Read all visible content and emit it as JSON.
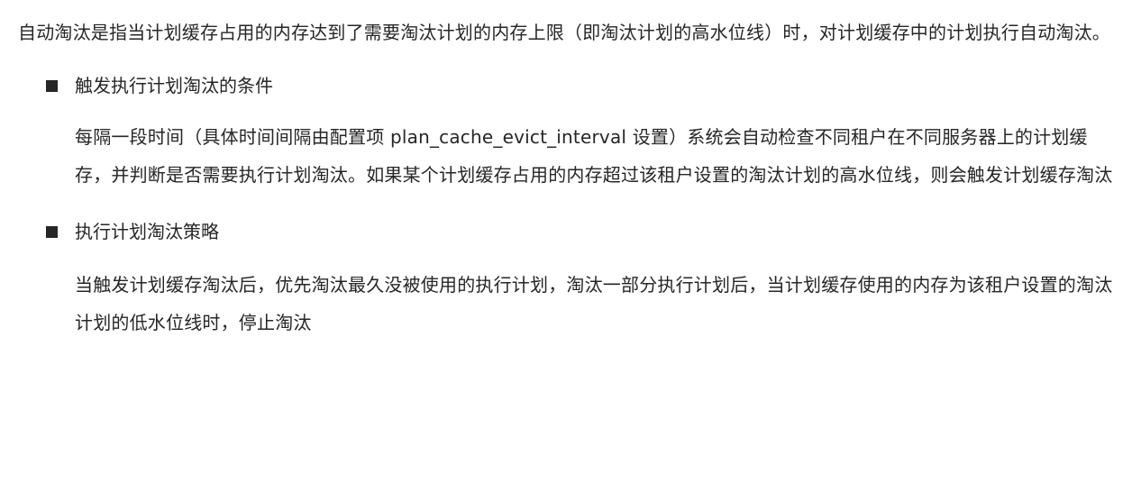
{
  "intro": "自动淘汰是指当计划缓存占用的内存达到了需要淘汰计划的内存上限（即淘汰计划的高水位线）时，对计划缓存中的计划执行自动淘汰。",
  "sections": [
    {
      "heading": "触发执行计划淘汰的条件",
      "body": "每隔一段时间（具体时间间隔由配置项 plan_cache_evict_interval 设置）系统会自动检查不同租户在不同服务器上的计划缓存，并判断是否需要执行计划淘汰。如果某个计划缓存占用的内存超过该租户设置的淘汰计划的高水位线，则会触发计划缓存淘汰"
    },
    {
      "heading": "执行计划淘汰策略",
      "body": "当触发计划缓存淘汰后，优先淘汰最久没被使用的执行计划，淘汰一部分执行计划后，当计划缓存使用的内存为该租户设置的淘汰计划的低水位线时，停止淘汰"
    }
  ]
}
